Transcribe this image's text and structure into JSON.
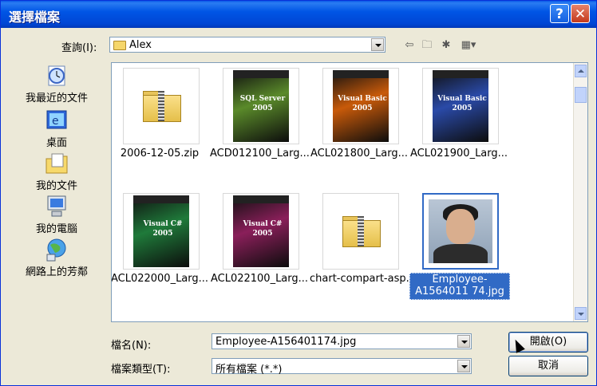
{
  "window": {
    "title": "選擇檔案"
  },
  "lookin": {
    "label": "查詢(I):",
    "value": "Alex"
  },
  "toolbar": {
    "back_icon": "back-arrow-icon",
    "up_icon": "up-folder-icon",
    "new_icon": "new-folder-icon",
    "views_icon": "views-menu-icon"
  },
  "places": [
    {
      "label": "我最近的文件",
      "icon": "recent-documents-icon"
    },
    {
      "label": "桌面",
      "icon": "desktop-icon"
    },
    {
      "label": "我的文件",
      "icon": "my-documents-icon"
    },
    {
      "label": "我的電腦",
      "icon": "my-computer-icon"
    },
    {
      "label": "網路上的芳鄰",
      "icon": "network-places-icon"
    }
  ],
  "files": [
    {
      "name": "2006-12-05.zip",
      "kind": "zip"
    },
    {
      "name": "ACD012100_Larg...",
      "kind": "cover",
      "cover_title": "SQL Server 2005",
      "accent": "#5a8a2a"
    },
    {
      "name": "ACL021800_Larg...",
      "kind": "cover",
      "cover_title": "Visual Basic 2005",
      "accent": "#c85a0a"
    },
    {
      "name": "ACL021900_Larg...",
      "kind": "cover",
      "cover_title": "Visual Basic 2005",
      "accent": "#2a4aa8"
    },
    {
      "name": "ACL022000_Larg...",
      "kind": "cover",
      "cover_title": "Visual C# 2005",
      "accent": "#1f7a3a"
    },
    {
      "name": "ACL022100_Larg...",
      "kind": "cover",
      "cover_title": "Visual C# 2005",
      "accent": "#8a1f5a"
    },
    {
      "name": "chart-compart-asp...",
      "kind": "zip"
    },
    {
      "name": "Employee-A156401174.jpg",
      "display": "Employee-A1564011 74.jpg",
      "kind": "photo",
      "selected": true
    }
  ],
  "filename": {
    "label": "檔名(N):",
    "value": "Employee-A156401174.jpg"
  },
  "filetype": {
    "label": "檔案類型(T):",
    "value": "所有檔案 (*.*)"
  },
  "buttons": {
    "open": "開啟(O)",
    "cancel": "取消"
  },
  "colors": {
    "titlebar": "#0055e5",
    "selection": "#316ac5",
    "dialog_bg": "#ece9d8"
  }
}
